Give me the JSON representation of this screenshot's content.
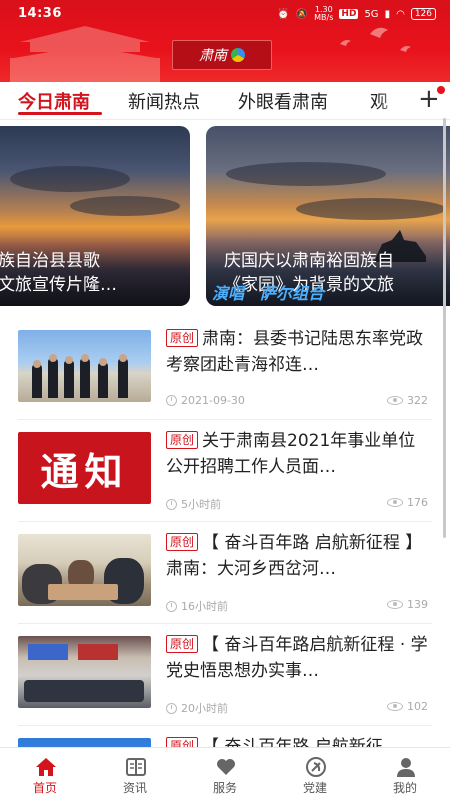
{
  "status_bar": {
    "time": "14:36",
    "net_speed": "1.30\nMB/s",
    "hd": "HD",
    "signal": "5G",
    "battery": "126"
  },
  "header": {
    "logo_text": "肃南",
    "brand_color": "#e8121c"
  },
  "tabs": [
    {
      "label": "今日肃南",
      "active": true
    },
    {
      "label": "新闻热点",
      "active": false
    },
    {
      "label": "外眼看肃南",
      "active": false
    },
    {
      "label": "观",
      "active": false
    }
  ],
  "tabs_add_label": "+",
  "carousel": [
    {
      "line1": "族自治县县歌",
      "line2": "文旅宣传片隆…"
    },
    {
      "line1": "庆国庆以肃南裕固族自",
      "line2": "《家园》为背景的文旅",
      "overlay": "演唱　萨尔组合"
    }
  ],
  "news": [
    {
      "badge": "原创",
      "title": "肃南：县委书记陆思东率党政考察团赴青海祁连…",
      "time": "2021-09-30",
      "views": "322",
      "thumb": "people"
    },
    {
      "badge": "原创",
      "title": "关于肃南县2021年事业单位公开招聘工作人员面…",
      "time": "5小时前",
      "views": "176",
      "thumb": "notice",
      "thumb_text": "通知"
    },
    {
      "badge": "原创",
      "title": "【 奋斗百年路 启航新征程 】肃南：大河乡西岔河…",
      "time": "16小时前",
      "views": "139",
      "thumb": "meet1"
    },
    {
      "badge": "原创",
      "title": "【 奋斗百年路启航新征程 · 学党史悟思想办实事…",
      "time": "20小时前",
      "views": "102",
      "thumb": "meet2"
    },
    {
      "badge": "原创",
      "title": "【 奋斗百年路 启航新征",
      "time": "",
      "views": "",
      "thumb": "blue"
    }
  ],
  "bottom_nav": [
    {
      "label": "首页",
      "icon": "home-icon",
      "active": true
    },
    {
      "label": "资讯",
      "icon": "newspaper-icon",
      "active": false
    },
    {
      "label": "服务",
      "icon": "heart-icon",
      "active": false
    },
    {
      "label": "党建",
      "icon": "party-emblem-icon",
      "active": false
    },
    {
      "label": "我的",
      "icon": "user-icon",
      "active": false
    }
  ]
}
